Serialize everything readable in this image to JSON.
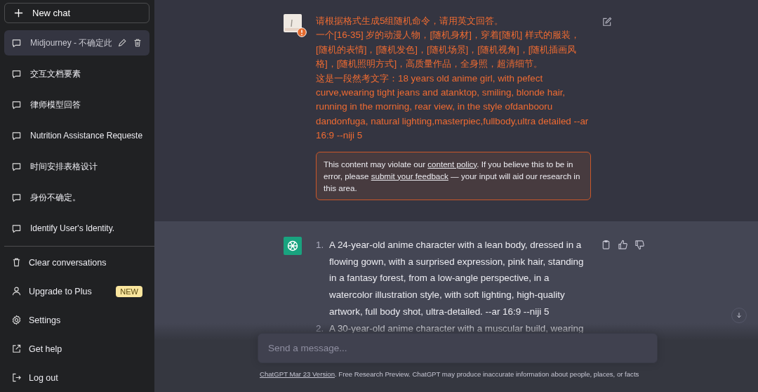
{
  "sidebar": {
    "new_chat": {
      "label": "New chat"
    },
    "conversations": [
      {
        "title": "Midjourney - 不确定此",
        "selected": true
      },
      {
        "title": "交互文档要素",
        "selected": false
      },
      {
        "title": "律师模型回答",
        "selected": false
      },
      {
        "title": "Nutrition Assistance Requeste",
        "selected": false
      },
      {
        "title": "时间安排表格设计",
        "selected": false
      },
      {
        "title": "身份不确定。",
        "selected": false
      },
      {
        "title": "Identify User's Identity.",
        "selected": false
      }
    ],
    "menu": [
      {
        "kind": "trash",
        "label": "Clear conversations"
      },
      {
        "kind": "user",
        "label": "Upgrade to Plus",
        "badge": "NEW"
      },
      {
        "kind": "gear",
        "label": "Settings"
      },
      {
        "kind": "external",
        "label": "Get help"
      },
      {
        "kind": "logout",
        "label": "Log out"
      }
    ]
  },
  "user_message": {
    "flagged": true,
    "paragraphs": [
      "请根据格式生成5组随机命令，请用英文回答。",
      "一个[16-35] 岁的动漫人物，[随机身材]，穿着[随机] 样式的服装，[随机的表情]，[随机发色]，[随机场景]，[随机视角]，[随机插画风格]，[随机照明方式]，高质量作品，全身照，超清细节。",
      "这是一段然考文字：18 years old anime girl, with pefect curve,wearing tight jeans and atanktop, smiling, blonde hair, running in the morning, rear view, in the style ofdanbooru dandonfuga, natural lighting,masterpiec,fullbody,ultra detailed --ar 16:9 --niji 5"
    ]
  },
  "warning": {
    "text_before": "This content may violate our ",
    "policy_link": "content policy",
    "text_middle": ". If you believe this to be in error, please ",
    "feedback_link": "submit your feedback",
    "text_after": " — your input will aid our research in this area."
  },
  "assistant_message": {
    "items": [
      {
        "number": "1.",
        "text": "A 24-year-old anime character with a lean body, dressed in a flowing gown, with a surprised expression, pink hair, standing in a fantasy forest, from a low-angle perspective, in a watercolor illustration style, with soft lighting, high-quality artwork, full body shot, ultra-detailed. --ar 16:9 --niji 5"
      },
      {
        "number": "2.",
        "text": "A 30-year-old anime character with a muscular build, wearing"
      }
    ]
  },
  "composer": {
    "placeholder": "Send a message..."
  },
  "footer": {
    "link": "ChatGPT Mar 23 Version",
    "text": ". Free Research Preview. ChatGPT may produce inaccurate information about people, places, or facts"
  }
}
